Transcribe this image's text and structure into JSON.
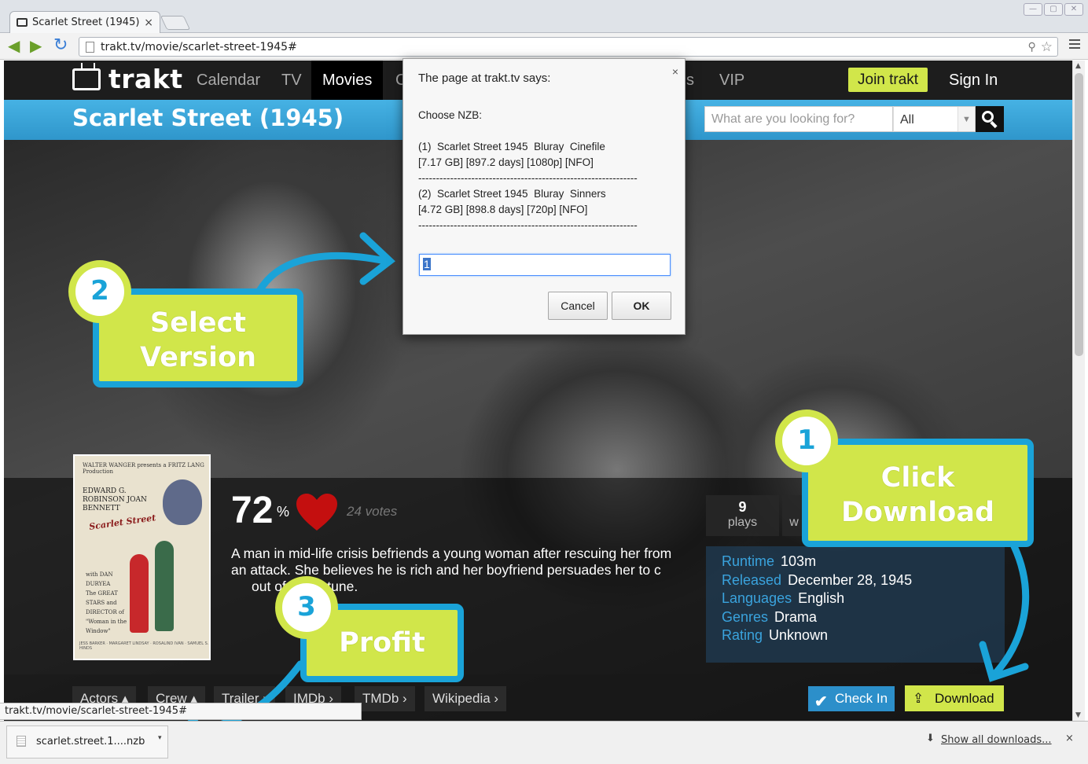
{
  "browser": {
    "tab_title": "Scarlet Street (1945)",
    "tab_close": "×",
    "url": "trakt.tv/movie/scarlet-street-1945#",
    "status_url": "trakt.tv/movie/scarlet-street-1945#"
  },
  "site": {
    "logo": "trakt",
    "nav": [
      "Calendar",
      "TV",
      "Movies",
      "C",
      "s",
      "VIP"
    ],
    "join_label": "Join trakt",
    "signin_label": "Sign In",
    "page_title": "Scarlet Street (1945)",
    "search": {
      "placeholder": "What are you looking for?",
      "scope": "All"
    }
  },
  "movie": {
    "rating_value": "72",
    "rating_sign": "%",
    "votes": "24 votes",
    "overview": "A man in mid-life crisis befriends a young woman after rescuing her from an attack. She believes he is rich and her boyfriend persuades her to c",
    "overview_tail": "out of his fortune.",
    "stats": {
      "plays_count": "9",
      "plays_label": "plays",
      "watchers_label_partial": "w"
    },
    "details": {
      "runtime_label": "Runtime",
      "runtime": "103m",
      "released_label": "Released",
      "released": "December 28, 1945",
      "languages_label": "Languages",
      "languages": "English",
      "genres_label": "Genres",
      "genres": "Drama",
      "rating_label": "Rating",
      "rating": "Unknown"
    },
    "tags": [
      "Actors",
      "Crew",
      "Trailer",
      "IMDb",
      "TMDb",
      "Wikipedia"
    ],
    "checkin_label": "Check In",
    "download_label": "Download",
    "poster": {
      "top": "WALTER WANGER presents a FRITZ LANG Production",
      "names": "EDWARD G. ROBINSON  JOAN BENNETT",
      "title": "Scarlet Street",
      "with": "with DAN DURYEA",
      "tagline": "The GREAT STARS and DIRECTOR of \"Woman in the Window\"",
      "credits": "JESS BARKER · MARGARET LINDSAY · ROSALIND IVAN · SAMUEL S. HINDS"
    }
  },
  "dialog": {
    "header": "The page at trakt.tv says:",
    "close": "×",
    "lines": [
      "Choose NZB:",
      "",
      "(1)  Scarlet Street 1945  Bluray  Cinefile",
      "[7.17 GB] [897.2 days] [1080p] [NFO]",
      "--------------------------------------------------------------",
      "(2)  Scarlet Street 1945  Bluray  Sinners",
      "[4.72 GB] [898.8 days] [720p] [NFO]",
      "--------------------------------------------------------------"
    ],
    "input_value": "1",
    "cancel_label": "Cancel",
    "ok_label": "OK"
  },
  "tutorial": {
    "step1": {
      "number": "1",
      "line1": "Click",
      "line2": "Download"
    },
    "step2": {
      "number": "2",
      "line1": "Select",
      "line2": "Version"
    },
    "step3": {
      "number": "3",
      "line1": "Profit"
    }
  },
  "downloads": {
    "file_name": "scarlet.street.1....nzb",
    "show_all": "Show all downloads...",
    "close": "×"
  },
  "colors": {
    "accent_green": "#d1e64a",
    "accent_blue": "#1aa3d8",
    "site_blue": "#2f96cb"
  }
}
